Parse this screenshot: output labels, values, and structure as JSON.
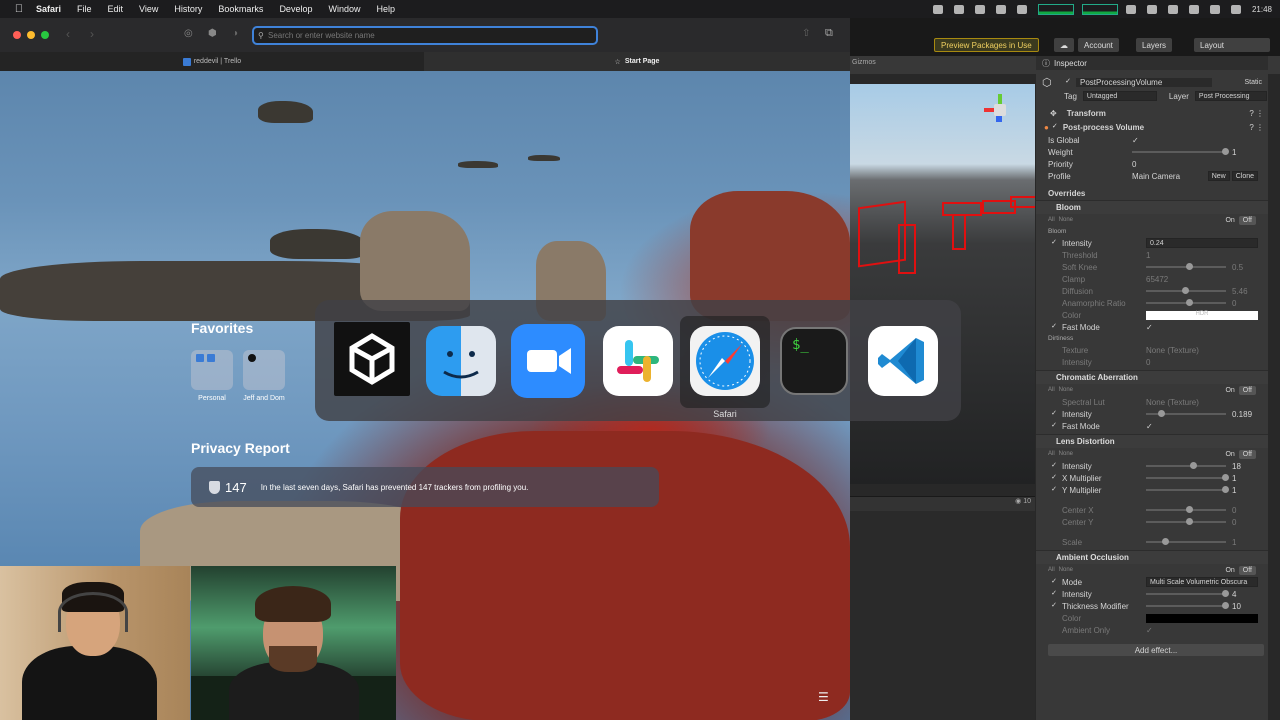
{
  "menubar": {
    "app": "Safari",
    "items": [
      "File",
      "Edit",
      "View",
      "History",
      "Bookmarks",
      "Develop",
      "Window",
      "Help"
    ],
    "clock": "21:48"
  },
  "safari": {
    "address_placeholder": "Search or enter website name",
    "tabs": [
      {
        "label": "reddevil | Trello"
      },
      {
        "label": "Start Page"
      }
    ],
    "favorites_title": "Favorites",
    "favorites": [
      {
        "label": "Personal"
      },
      {
        "label": "Jeff and Dom"
      }
    ],
    "privacy_title": "Privacy Report",
    "privacy_count": "147",
    "privacy_text": "In the last seven days, Safari has prevented 147 trackers from profiling you."
  },
  "switcher": {
    "apps": [
      {
        "name": "Unity",
        "icon": "unity-icon"
      },
      {
        "name": "Finder",
        "icon": "finder-icon"
      },
      {
        "name": "Zoom",
        "icon": "zoom-icon"
      },
      {
        "name": "Slack",
        "icon": "slack-icon"
      },
      {
        "name": "Safari",
        "icon": "safari-icon"
      },
      {
        "name": "Terminal",
        "icon": "terminal-icon"
      },
      {
        "name": "Visual Studio Code",
        "icon": "vscode-icon"
      }
    ],
    "selected_label": "Safari"
  },
  "unity": {
    "preview_packages": "Preview Packages in Use",
    "account": "Account",
    "layers": "Layers",
    "layout": "Layout",
    "gizmos": "Gizmos",
    "scene_count": "10",
    "inspector": {
      "tab": "Inspector",
      "object_name": "PostProcessingVolume",
      "static": "Static",
      "tag_label": "Tag",
      "tag_value": "Untagged",
      "layer_label": "Layer",
      "layer_value": "Post Processing",
      "transform": "Transform",
      "component": "Post-process Volume",
      "is_global": "Is Global",
      "weight_label": "Weight",
      "weight_value": "1",
      "priority_label": "Priority",
      "priority_value": "0",
      "profile_label": "Profile",
      "profile_value": "Main Camera",
      "new_btn": "New",
      "clone_btn": "Clone",
      "overrides": "Overrides",
      "all": "All",
      "none": "None",
      "on": "On",
      "off": "Off",
      "bloom": {
        "title": "Bloom",
        "sub": "Bloom",
        "intensity_label": "Intensity",
        "intensity_value": "0.24",
        "threshold_label": "Threshold",
        "threshold_value": "1",
        "softknee_label": "Soft Knee",
        "softknee_value": "0.5",
        "clamp_label": "Clamp",
        "clamp_value": "65472",
        "diffusion_label": "Diffusion",
        "diffusion_value": "5.46",
        "anamorphic_label": "Anamorphic Ratio",
        "anamorphic_value": "0",
        "color_label": "Color",
        "color_value": "HDR",
        "fastmode_label": "Fast Mode",
        "dirtiness": "Dirtiness",
        "texture_label": "Texture",
        "texture_value": "None (Texture)",
        "dirt_intensity_label": "Intensity",
        "dirt_intensity_value": "0"
      },
      "chromatic": {
        "title": "Chromatic Aberration",
        "spectral_label": "Spectral Lut",
        "spectral_value": "None (Texture)",
        "intensity_label": "Intensity",
        "intensity_value": "0.189",
        "fastmode_label": "Fast Mode"
      },
      "lens": {
        "title": "Lens Distortion",
        "intensity_label": "Intensity",
        "intensity_value": "18",
        "xmul_label": "X Multiplier",
        "xmul_value": "1",
        "ymul_label": "Y Multiplier",
        "ymul_value": "1",
        "centerx_label": "Center X",
        "centerx_value": "0",
        "centery_label": "Center Y",
        "centery_value": "0",
        "scale_label": "Scale",
        "scale_value": "1"
      },
      "ao": {
        "title": "Ambient Occlusion",
        "mode_label": "Mode",
        "mode_value": "Multi Scale Volumetric Obscura",
        "intensity_label": "Intensity",
        "intensity_value": "4",
        "thickness_label": "Thickness Modifier",
        "thickness_value": "10",
        "color_label": "Color",
        "ambient_only_label": "Ambient Only"
      },
      "add_effect": "Add effect..."
    }
  }
}
